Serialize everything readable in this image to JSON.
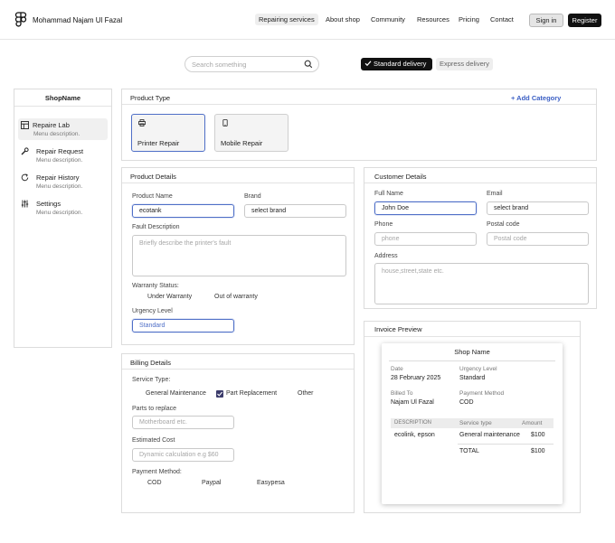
{
  "header": {
    "brand": "Mohammad Najam Ul Fazal",
    "nav": [
      "Repairing services",
      "About shop",
      "Community",
      "Resources",
      "Pricing",
      "Contact"
    ],
    "signin": "Sign in",
    "register": "Register"
  },
  "search": {
    "placeholder": "Search something"
  },
  "delivery": {
    "standard": "Standard delivery",
    "express": "Express delivery"
  },
  "sidebar": {
    "title": "ShopName",
    "items": [
      {
        "label": "Repaire Lab",
        "desc": "Menu description."
      },
      {
        "label": "Repair Request",
        "desc": "Menu description."
      },
      {
        "label": "Repair History",
        "desc": "Menu description."
      },
      {
        "label": "Settings",
        "desc": "Menu description."
      }
    ]
  },
  "product_type": {
    "title": "Product Type",
    "add": "+ Add Category",
    "tiles": [
      "Printer Repair",
      "Mobile Repair"
    ]
  },
  "product_details": {
    "title": "Product Details",
    "name_label": "Product Name",
    "name_value": "ecotank",
    "brand_label": "Brand",
    "brand_value": "select brand",
    "fault_label": "Fault Description",
    "fault_placeholder": "Briefly describe the printer's fault",
    "warranty_label": "Warranty Status:",
    "warranty_opts": [
      "Under Warranty",
      "Out of warranty"
    ],
    "urgency_label": "Urgency Level",
    "urgency_value": "Standard"
  },
  "customer": {
    "title": "Customer Details",
    "fullname_label": "Full Name",
    "fullname_value": "John Doe",
    "email_label": "Email",
    "email_value": "select brand",
    "phone_label": "Phone",
    "phone_placeholder": "phone",
    "postal_label": "Postal code",
    "postal_placeholder": "Postal code",
    "address_label": "Address",
    "address_placeholder": "house,street,state etc."
  },
  "billing": {
    "title": "Billing Details",
    "service_label": "Service Type:",
    "service_opts": [
      "General Maintenance",
      "Part Replacement",
      "Other"
    ],
    "parts_label": "Parts to replace",
    "parts_placeholder": "Motherboard etc.",
    "cost_label": "Estimated Cost",
    "cost_placeholder": "Dynamic calculation e.g $60",
    "payment_label": "Payment Method:",
    "payment_opts": [
      "COD",
      "Paypal",
      "Easypesa"
    ]
  },
  "invoice": {
    "section_title": "Invoice Preview",
    "shop": "Shop Name",
    "date_label": "Date",
    "date_value": "28 February 2025",
    "urgency_label": "Urgency Level",
    "urgency_value": "Standard",
    "billed_label": "Billed To",
    "billed_value": "Najam Ul Fazal",
    "payment_label": "Payment Method",
    "payment_value": "COD",
    "cols": [
      "DESCRIPTION",
      "Service type",
      "Amount"
    ],
    "row": [
      "ecolink, epson",
      "General maintenance",
      "$100"
    ],
    "total_label": "TOTAL",
    "total_value": "$100"
  }
}
